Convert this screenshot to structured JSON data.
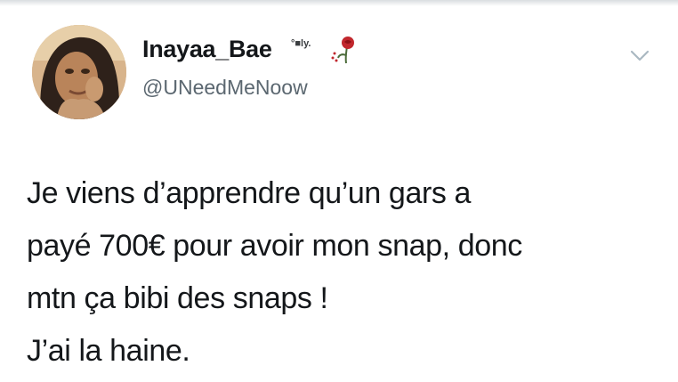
{
  "tweet": {
    "author": {
      "display_name": "Inayaa_Bae",
      "name_suffix": "°■ly.",
      "handle": "@UNeedMeNoow",
      "avatar_icon": "profile-photo",
      "badge_icon": "rose-icon"
    },
    "menu_icon": "chevron-down-icon",
    "text_lines": [
      "Je viens d’apprendre qu’un gars a",
      "payé 700€ pour avoir mon snap, donc",
      "mtn ça bibi des snaps !",
      "J’ai la haine."
    ]
  },
  "colors": {
    "text": "#14171a",
    "handle": "#5b6770",
    "chevron": "#aab8c2",
    "background": "#ffffff"
  }
}
